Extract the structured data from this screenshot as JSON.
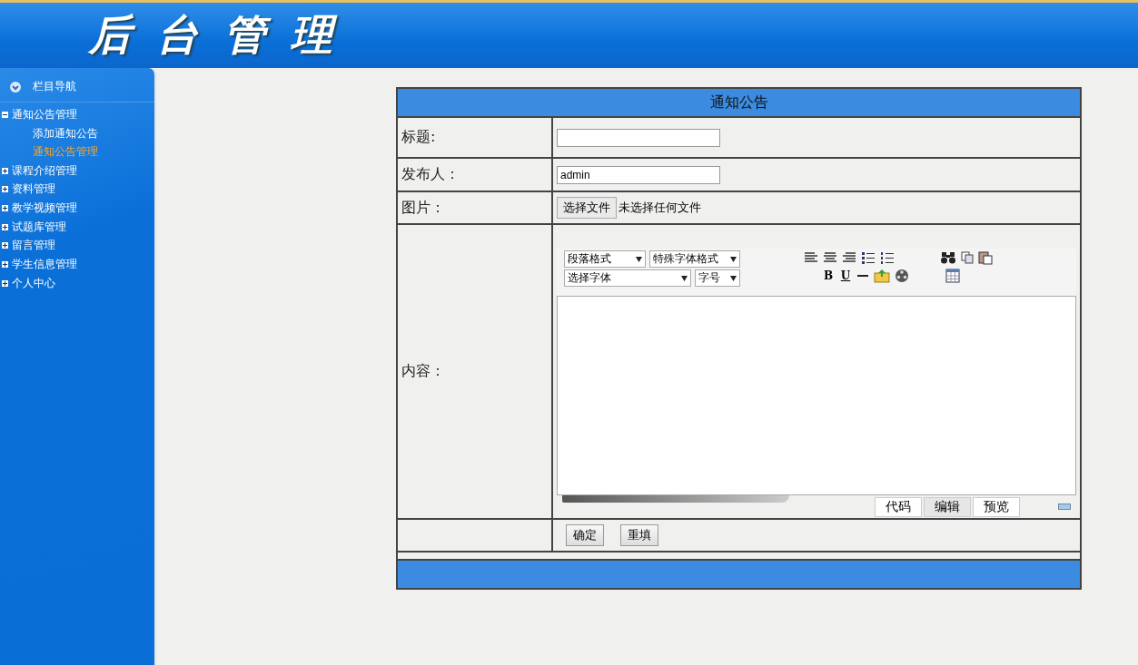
{
  "header": {
    "title": "后台管理"
  },
  "sidebar": {
    "title": "栏目导航",
    "items": [
      {
        "label": "通知公告管理",
        "expanded": true,
        "children": [
          {
            "label": "添加通知公告",
            "selected": false
          },
          {
            "label": "通知公告管理",
            "selected": true
          }
        ]
      },
      {
        "label": "课程介绍管理",
        "expanded": false
      },
      {
        "label": "资料管理",
        "expanded": false
      },
      {
        "label": "教学视频管理",
        "expanded": false
      },
      {
        "label": "试题库管理",
        "expanded": false
      },
      {
        "label": "留言管理",
        "expanded": false
      },
      {
        "label": "学生信息管理",
        "expanded": false
      },
      {
        "label": "个人中心",
        "expanded": false
      }
    ]
  },
  "form": {
    "title": "通知公告",
    "fields": [
      {
        "kind": "text",
        "label": "标题:"
      },
      {
        "kind": "text",
        "label": "发布人：",
        "value": "admin"
      },
      {
        "kind": "file",
        "label": "图片：",
        "button": "选择文件",
        "status": "未选择任何文件"
      }
    ],
    "content": {
      "label": "内容：",
      "selects": [
        {
          "label": "段落格式"
        },
        {
          "label": "特殊字体格式"
        },
        {
          "label": "选择字体"
        },
        {
          "label": "字号"
        }
      ],
      "format_buttons": [
        "B",
        "U"
      ],
      "tabs": [
        {
          "label": "代码",
          "selected": false
        },
        {
          "label": "编辑",
          "selected": true
        },
        {
          "label": "预览",
          "selected": false
        }
      ]
    },
    "buttons": [
      "确定",
      "重填"
    ]
  }
}
